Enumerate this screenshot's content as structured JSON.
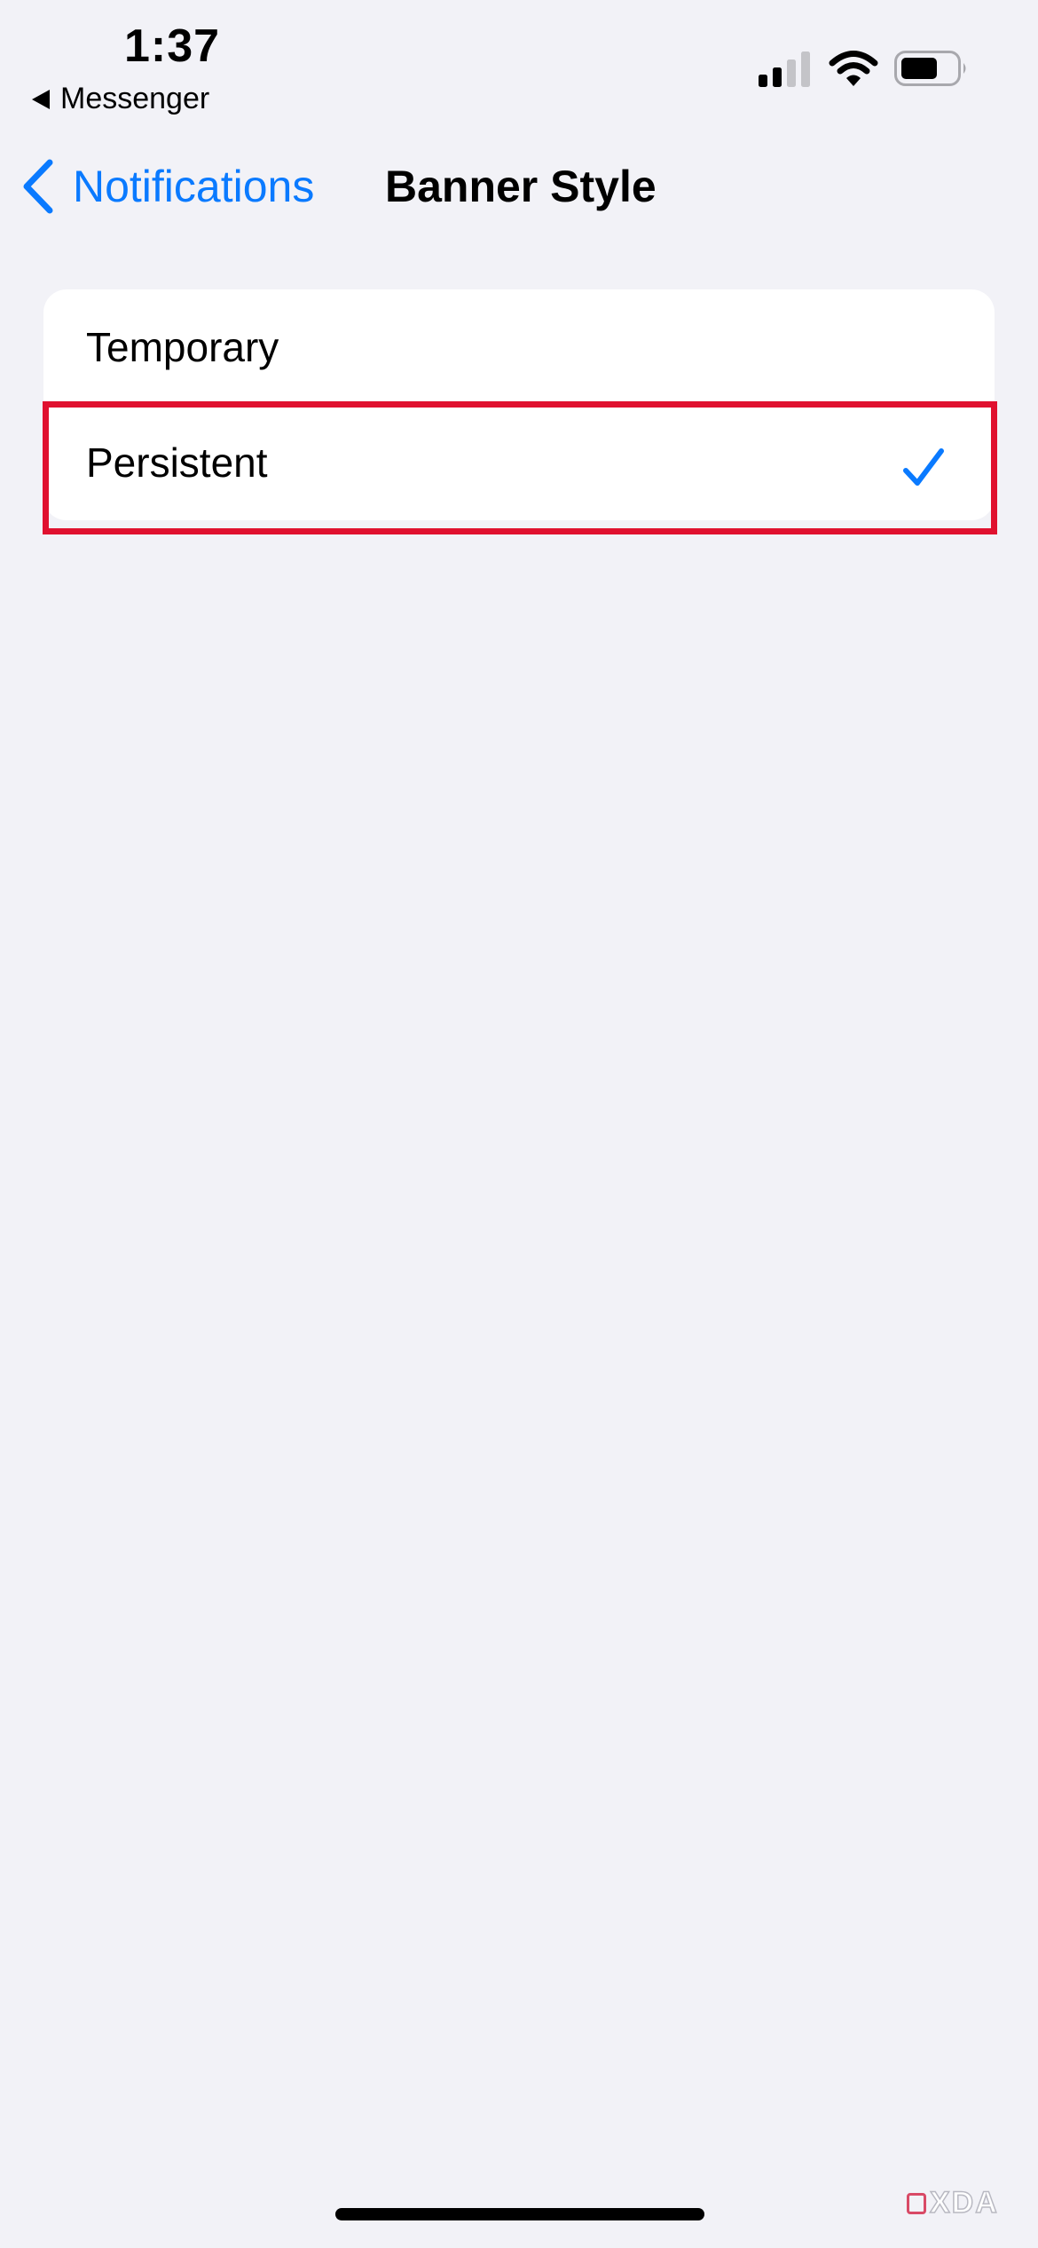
{
  "status_bar": {
    "time": "1:37",
    "back_app": "Messenger",
    "icons": [
      "signal-icon",
      "wifi-icon",
      "battery-icon"
    ]
  },
  "nav": {
    "back_label": "Notifications",
    "title": "Banner Style"
  },
  "options": [
    {
      "label": "Temporary",
      "selected": false
    },
    {
      "label": "Persistent",
      "selected": true
    }
  ],
  "watermark": "XDA",
  "colors": {
    "background": "#f2f2f7",
    "accent": "#0a7aff",
    "highlight": "#e0112f"
  }
}
